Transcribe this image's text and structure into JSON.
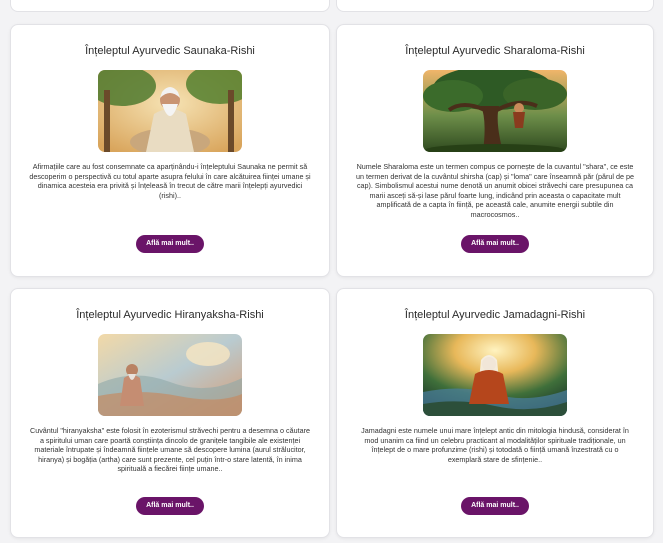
{
  "cards": [
    {
      "title": "Înțeleptul Ayurvedic Saunaka-Rishi",
      "description": "Afirmațiile care au fost consemnate ca aparținându-i înțeleptului Saunaka ne permit să descoperim o perspectivă cu totul aparte asupra felului în care alcătuirea ființei umane și dinamica acesteia era privită și înțeleasă în trecut de către marii înțelepți ayurvedici (rishi)..",
      "button_label": "Află mai mult.."
    },
    {
      "title": "Înțeleptul Ayurvedic Sharaloma-Rishi",
      "description": "Numele Sharaloma este un termen compus ce pornește de la cuvantul \"shara\", ce este un termen derivat de la cuvântul shirsha (cap) și \"loma\" care înseamnă păr (părul de pe cap). Simbolismul acestui nume denotă un anumit obicei străvechi care presupunea ca marii asceți să-și lase părul foarte lung, indicând prin aceasta o capacitate mult amplificată de a capta în ființă, pe această cale, anumite energii subtile din macrocosmos..",
      "button_label": "Află mai mult.."
    },
    {
      "title": "Înțeleptul Ayurvedic Hiranyaksha-Rishi",
      "description": "Cuvântul \"hiranyaksha\" este folosit în ezoterismul străvechi pentru a desemna o căutare a spiritului uman care poartă conștiința dincolo de granițele tangibile ale existenței materiale întrupate și îndeamnă ființele umane să descopere lumina (aurul strălucitor, hiranya) și bogăția (artha) care sunt prezente, cel puțin într-o stare latentă, în inima spirituală a fiecărei ființe umane..",
      "button_label": "Află mai mult.."
    },
    {
      "title": "Înțeleptul Ayurvedic Jamadagni-Rishi",
      "description": "Jamadagni este numele unui mare înțelept antic din mitologia hindusă, considerat în mod unanim ca fiind un celebru practicant al modalităților spirituale tradiționale, un înțelept de o mare profunzime (rishi) și totodată o ființă umană înzestrată cu o exemplară stare de sfințenie..",
      "button_label": "Află mai mult.."
    }
  ],
  "colors": {
    "button": "#6a1468",
    "card": "#ffffff",
    "background": "#f3f3f5"
  }
}
